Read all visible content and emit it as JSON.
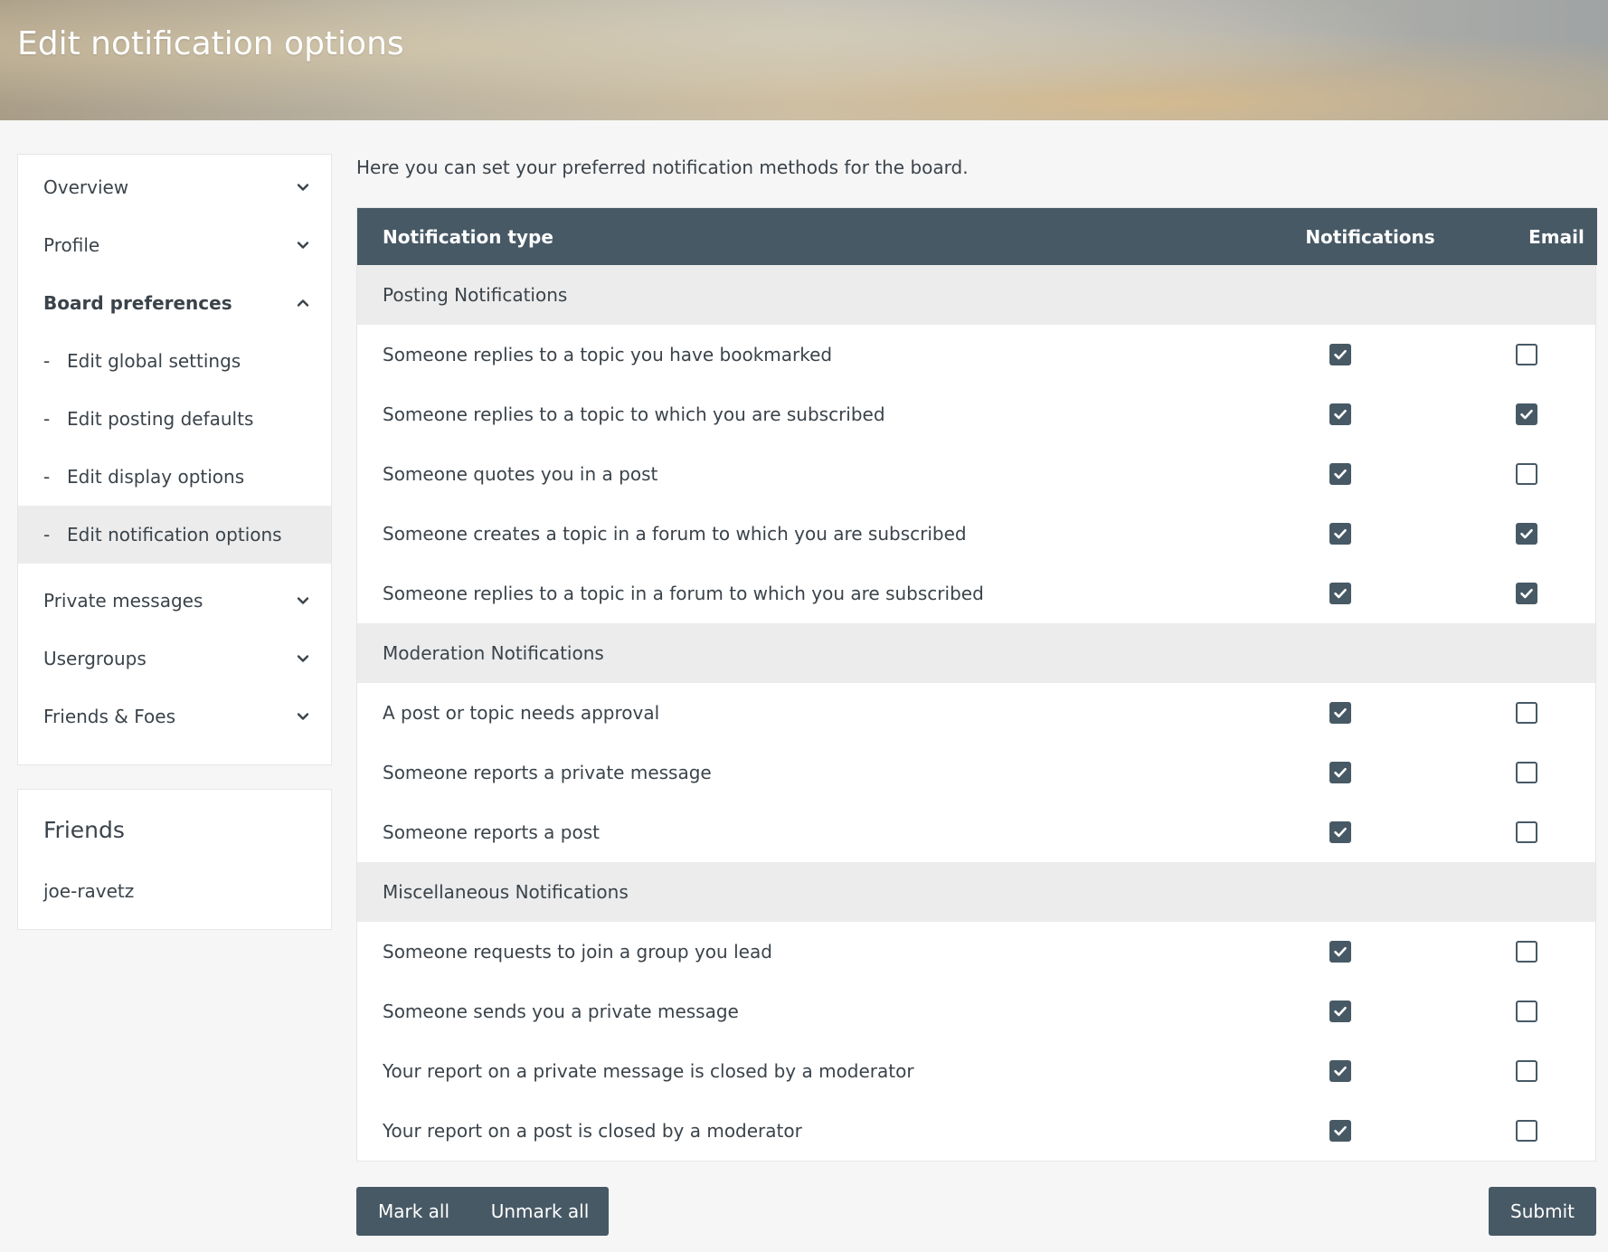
{
  "header": {
    "title": "Edit notification options"
  },
  "sidebar": {
    "items": [
      {
        "label": "Overview",
        "expanded": false
      },
      {
        "label": "Profile",
        "expanded": false
      },
      {
        "label": "Board preferences",
        "expanded": true
      },
      {
        "label": "Private messages",
        "expanded": false
      },
      {
        "label": "Usergroups",
        "expanded": false
      },
      {
        "label": "Friends & Foes",
        "expanded": false
      }
    ],
    "subitems": [
      {
        "dash": "-",
        "label": "Edit global settings",
        "active": false
      },
      {
        "dash": "-",
        "label": "Edit posting defaults",
        "active": false
      },
      {
        "dash": "-",
        "label": "Edit display options",
        "active": false
      },
      {
        "dash": "-",
        "label": "Edit notification options",
        "active": true
      }
    ]
  },
  "friends": {
    "title": "Friends",
    "list": [
      "joe-ravetz"
    ]
  },
  "main": {
    "intro": "Here you can set your preferred notification methods for the board.",
    "columns": [
      "Notification type",
      "Notifications",
      "Email"
    ],
    "groups": [
      {
        "title": "Posting Notifications",
        "rows": [
          {
            "label": "Someone replies to a topic you have bookmarked",
            "notifications": true,
            "email": false
          },
          {
            "label": "Someone replies to a topic to which you are subscribed",
            "notifications": true,
            "email": true
          },
          {
            "label": "Someone quotes you in a post",
            "notifications": true,
            "email": false
          },
          {
            "label": "Someone creates a topic in a forum to which you are subscribed",
            "notifications": true,
            "email": true
          },
          {
            "label": "Someone replies to a topic in a forum to which you are subscribed",
            "notifications": true,
            "email": true
          }
        ]
      },
      {
        "title": "Moderation Notifications",
        "rows": [
          {
            "label": "A post or topic needs approval",
            "notifications": true,
            "email": false
          },
          {
            "label": "Someone reports a private message",
            "notifications": true,
            "email": false
          },
          {
            "label": "Someone reports a post",
            "notifications": true,
            "email": false
          }
        ]
      },
      {
        "title": "Miscellaneous Notifications",
        "rows": [
          {
            "label": "Someone requests to join a group you lead",
            "notifications": true,
            "email": false
          },
          {
            "label": "Someone sends you a private message",
            "notifications": true,
            "email": false
          },
          {
            "label": "Your report on a private message is closed by a moderator",
            "notifications": true,
            "email": false
          },
          {
            "label": "Your report on a post is closed by a moderator",
            "notifications": true,
            "email": false
          }
        ]
      }
    ]
  },
  "actions": {
    "mark_all": "Mark all",
    "unmark_all": "Unmark all",
    "submit": "Submit"
  },
  "colors": {
    "accent": "#475965",
    "group_bg": "#ececec",
    "page_bg": "#f6f6f6"
  },
  "icons": {
    "collapsed": "chevron-down-icon",
    "expanded": "chevron-up-icon",
    "checked": "checkmark-icon"
  }
}
